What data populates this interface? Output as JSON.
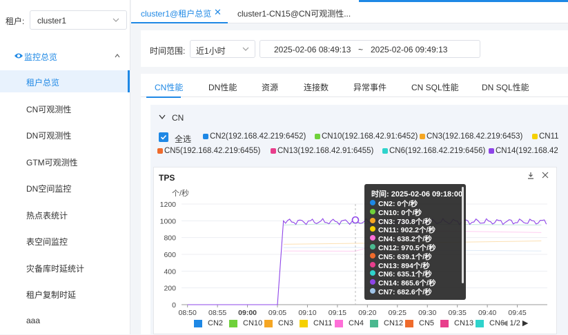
{
  "sidebar": {
    "tenant_label": "租户:",
    "tenant_value": "cluster1",
    "group_label": "监控总览",
    "items": [
      {
        "label": "租户总览",
        "active": true
      },
      {
        "label": "CN可观测性"
      },
      {
        "label": "DN可观测性"
      },
      {
        "label": "GTM可观测性"
      },
      {
        "label": "DN空间监控"
      },
      {
        "label": "热点表统计"
      },
      {
        "label": "表空间监控"
      },
      {
        "label": "灾备库时延统计"
      },
      {
        "label": "租户复制时延"
      },
      {
        "label": "aaa"
      }
    ]
  },
  "tabs": [
    {
      "label": "cluster1@租户总览",
      "active": true
    },
    {
      "label": "cluster1-CN15@CN可观测性..."
    }
  ],
  "filter": {
    "label": "时间范围:",
    "range": "近1小时",
    "start": "2025-02-06 08:49:13",
    "sep": "~",
    "end": "2025-02-06 09:49:13"
  },
  "subtabs": [
    "CN性能",
    "DN性能",
    "资源",
    "连接数",
    "异常事件",
    "CN SQL性能",
    "DN SQL性能"
  ],
  "cn_panel": {
    "title": "CN",
    "select_all": "全选",
    "legend_row1": [
      {
        "label": "CN2(192.168.42.219:6452)",
        "color": "#1e88e5"
      },
      {
        "label": "CN10(192.168.42.91:6452)",
        "color": "#6fd13a"
      },
      {
        "label": "CN3(192.168.42.219:6453)",
        "color": "#f5a623"
      },
      {
        "label": "CN11",
        "color": "#f5d000"
      }
    ],
    "legend_row2": [
      {
        "label": "CN5(192.168.42.219:6455)",
        "color": "#ef6b2c"
      },
      {
        "label": "CN13(192.168.42.91:6455)",
        "color": "#e83e8c"
      },
      {
        "label": "CN6(192.168.42.219:6456)",
        "color": "#2fd3cc"
      },
      {
        "label": "CN14(192.168.42",
        "color": "#8e44e8"
      }
    ]
  },
  "chart_data": {
    "type": "line",
    "title": "TPS",
    "ylabel": "个/秒",
    "ylim": [
      0,
      1200
    ],
    "yticks": [
      0,
      200,
      400,
      600,
      800,
      1000,
      1200
    ],
    "xticks": [
      "08:50",
      "08:55",
      "09:00",
      "09:05",
      "09:10",
      "09:15",
      "09:20",
      "09:25",
      "09:30",
      "09:35",
      "09:40",
      "09:45"
    ],
    "bold_xtick": "09:00",
    "series": [
      {
        "name": "CN14",
        "color": "#8e44e8",
        "x": [
          "08:50",
          "09:05",
          "09:06",
          "09:10",
          "09:15",
          "09:18",
          "09:20",
          "09:30",
          "09:40",
          "09:49"
        ],
        "values": [
          0,
          0,
          1000,
          960,
          1000,
          866,
          1010,
          1000,
          1005,
          1000
        ]
      },
      {
        "name": "CN3",
        "color": "#f5a623",
        "x": [
          "09:06",
          "09:18",
          "09:30",
          "09:49"
        ],
        "values": [
          720,
          731,
          740,
          760
        ]
      },
      {
        "name": "CN12",
        "color": "#4ab88f",
        "x": [
          "09:06",
          "09:18",
          "09:30",
          "09:49"
        ],
        "values": [
          950,
          970,
          960,
          950
        ]
      },
      {
        "name": "CN7",
        "color": "#a0c4e8",
        "x": [
          "09:06",
          "09:18",
          "09:30",
          "09:49"
        ],
        "values": [
          680,
          683,
          650,
          640
        ]
      },
      {
        "name": "CN4",
        "color": "#ff6fd8",
        "x": [
          "09:06",
          "09:18",
          "09:30",
          "09:49"
        ],
        "values": [
          640,
          638,
          880,
          860
        ]
      }
    ],
    "bottom_legend": [
      {
        "name": "CN2",
        "color": "#1e88e5"
      },
      {
        "name": "CN10",
        "color": "#6fd13a"
      },
      {
        "name": "CN3",
        "color": "#f5a623"
      },
      {
        "name": "CN11",
        "color": "#f5d000"
      },
      {
        "name": "CN4",
        "color": "#ff6fd8"
      },
      {
        "name": "CN12",
        "color": "#4ab88f"
      },
      {
        "name": "CN5",
        "color": "#ef6b2c"
      },
      {
        "name": "CN13",
        "color": "#e83e8c"
      },
      {
        "name": "CN6",
        "color": "#2fd3cc"
      }
    ],
    "pager": "1/2"
  },
  "tooltip": {
    "title": "时间: 2025-02-06 09:18:00",
    "rows": [
      {
        "label": "CN2: 0个/秒",
        "color": "#1e88e5"
      },
      {
        "label": "CN10: 0个/秒",
        "color": "#6fd13a"
      },
      {
        "label": "CN3: 730.8个/秒",
        "color": "#f5a623"
      },
      {
        "label": "CN11: 902.2个/秒",
        "color": "#f5d000"
      },
      {
        "label": "CN4: 638.2个/秒",
        "color": "#ff6fd8"
      },
      {
        "label": "CN12: 970.5个/秒",
        "color": "#4ab88f"
      },
      {
        "label": "CN5: 639.1个/秒",
        "color": "#ef6b2c"
      },
      {
        "label": "CN13: 894个/秒",
        "color": "#e83e8c"
      },
      {
        "label": "CN6: 635.1个/秒",
        "color": "#2fd3cc"
      },
      {
        "label": "CN14: 865.6个/秒",
        "color": "#8e44e8"
      },
      {
        "label": "CN7: 682.6个/秒",
        "color": "#a0c4e8"
      }
    ]
  }
}
